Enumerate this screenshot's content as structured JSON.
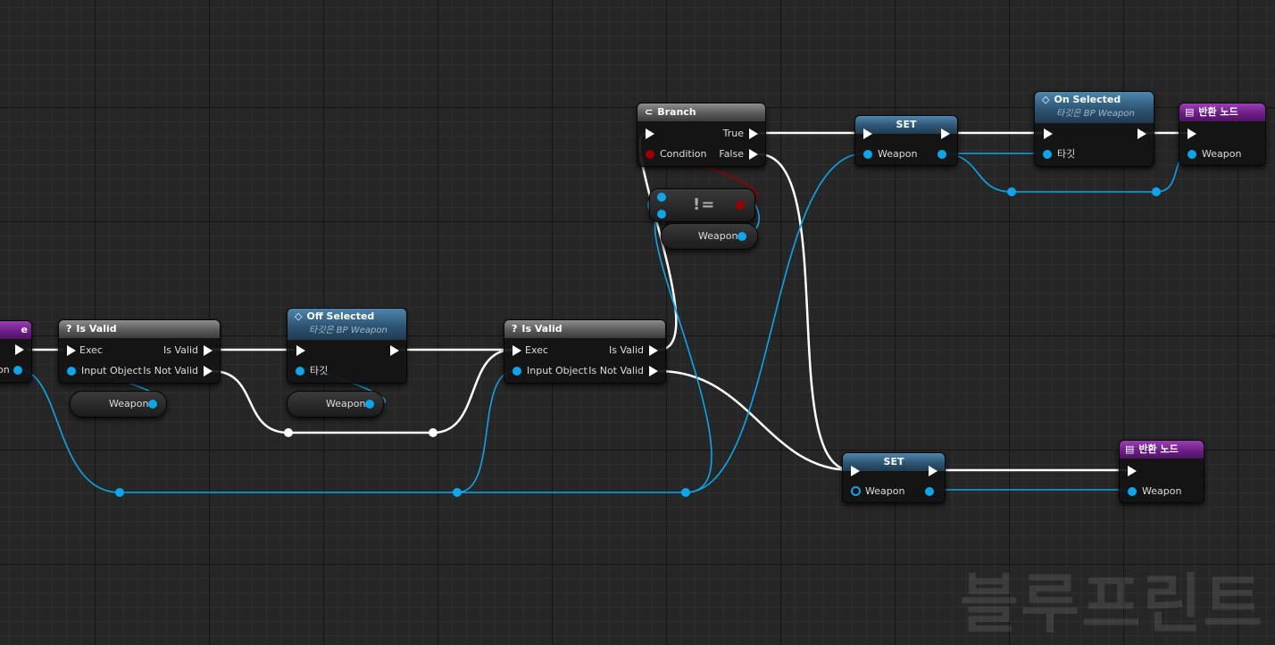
{
  "watermark": "블루프린트",
  "colors": {
    "exec_wire": "#ffffff",
    "object_wire": "#0ba6ec",
    "bool_wire": "#9a0000",
    "pure_header": "#5a5a5a",
    "event_header": "#2e5574",
    "return_header": "#6a1c84"
  },
  "nodes": {
    "partial_left": {
      "title": "e",
      "output_label": "on"
    },
    "is_valid_1": {
      "icon": "?",
      "title": "Is Valid",
      "exec_in": "Exec",
      "input_object": "Input Object",
      "is_valid": "Is Valid",
      "is_not_valid": "Is Not Valid"
    },
    "weapon_getter_1": {
      "label": "Weapon"
    },
    "off_selected": {
      "title": "Off Selected",
      "subtitle": "타깃은 BP Weapon",
      "target": "타깃"
    },
    "weapon_getter_2": {
      "label": "Weapon"
    },
    "is_valid_2": {
      "icon": "?",
      "title": "Is Valid",
      "exec_in": "Exec",
      "input_object": "Input Object",
      "is_valid": "Is Valid",
      "is_not_valid": "Is Not Valid"
    },
    "branch": {
      "title": "Branch",
      "condition": "Condition",
      "true_label": "True",
      "false_label": "False"
    },
    "not_equal": {
      "label": "!="
    },
    "weapon_getter_3": {
      "label": "Weapon"
    },
    "set_top": {
      "title": "SET",
      "pin": "Weapon"
    },
    "on_selected": {
      "title": "On Selected",
      "subtitle": "타깃은 BP Weapon",
      "target": "타깃"
    },
    "return_top": {
      "title": "반환 노드",
      "pin": "Weapon"
    },
    "set_bottom": {
      "title": "SET",
      "pin": "Weapon"
    },
    "return_bottom": {
      "title": "반환 노드",
      "pin": "Weapon"
    }
  }
}
